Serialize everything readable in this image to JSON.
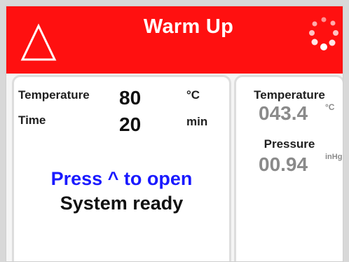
{
  "header": {
    "title": "Warm Up",
    "background_color": "#ff1010",
    "warning_icon": "warning-triangle-icon",
    "status_icon": "loading-spinner-icon"
  },
  "setpoint_panel": {
    "temperature": {
      "label": "Temperature",
      "value": "80",
      "unit": "°C"
    },
    "time": {
      "label": "Time",
      "value": "20",
      "unit": "min"
    },
    "message": "Press ^ to open",
    "message_color": "#1a1aff",
    "status": "System ready"
  },
  "readout_panel": {
    "temperature": {
      "label": "Temperature",
      "value": "043.4",
      "unit": "°C"
    },
    "pressure": {
      "label": "Pressure",
      "value": "00.94",
      "unit": "inHg"
    }
  }
}
